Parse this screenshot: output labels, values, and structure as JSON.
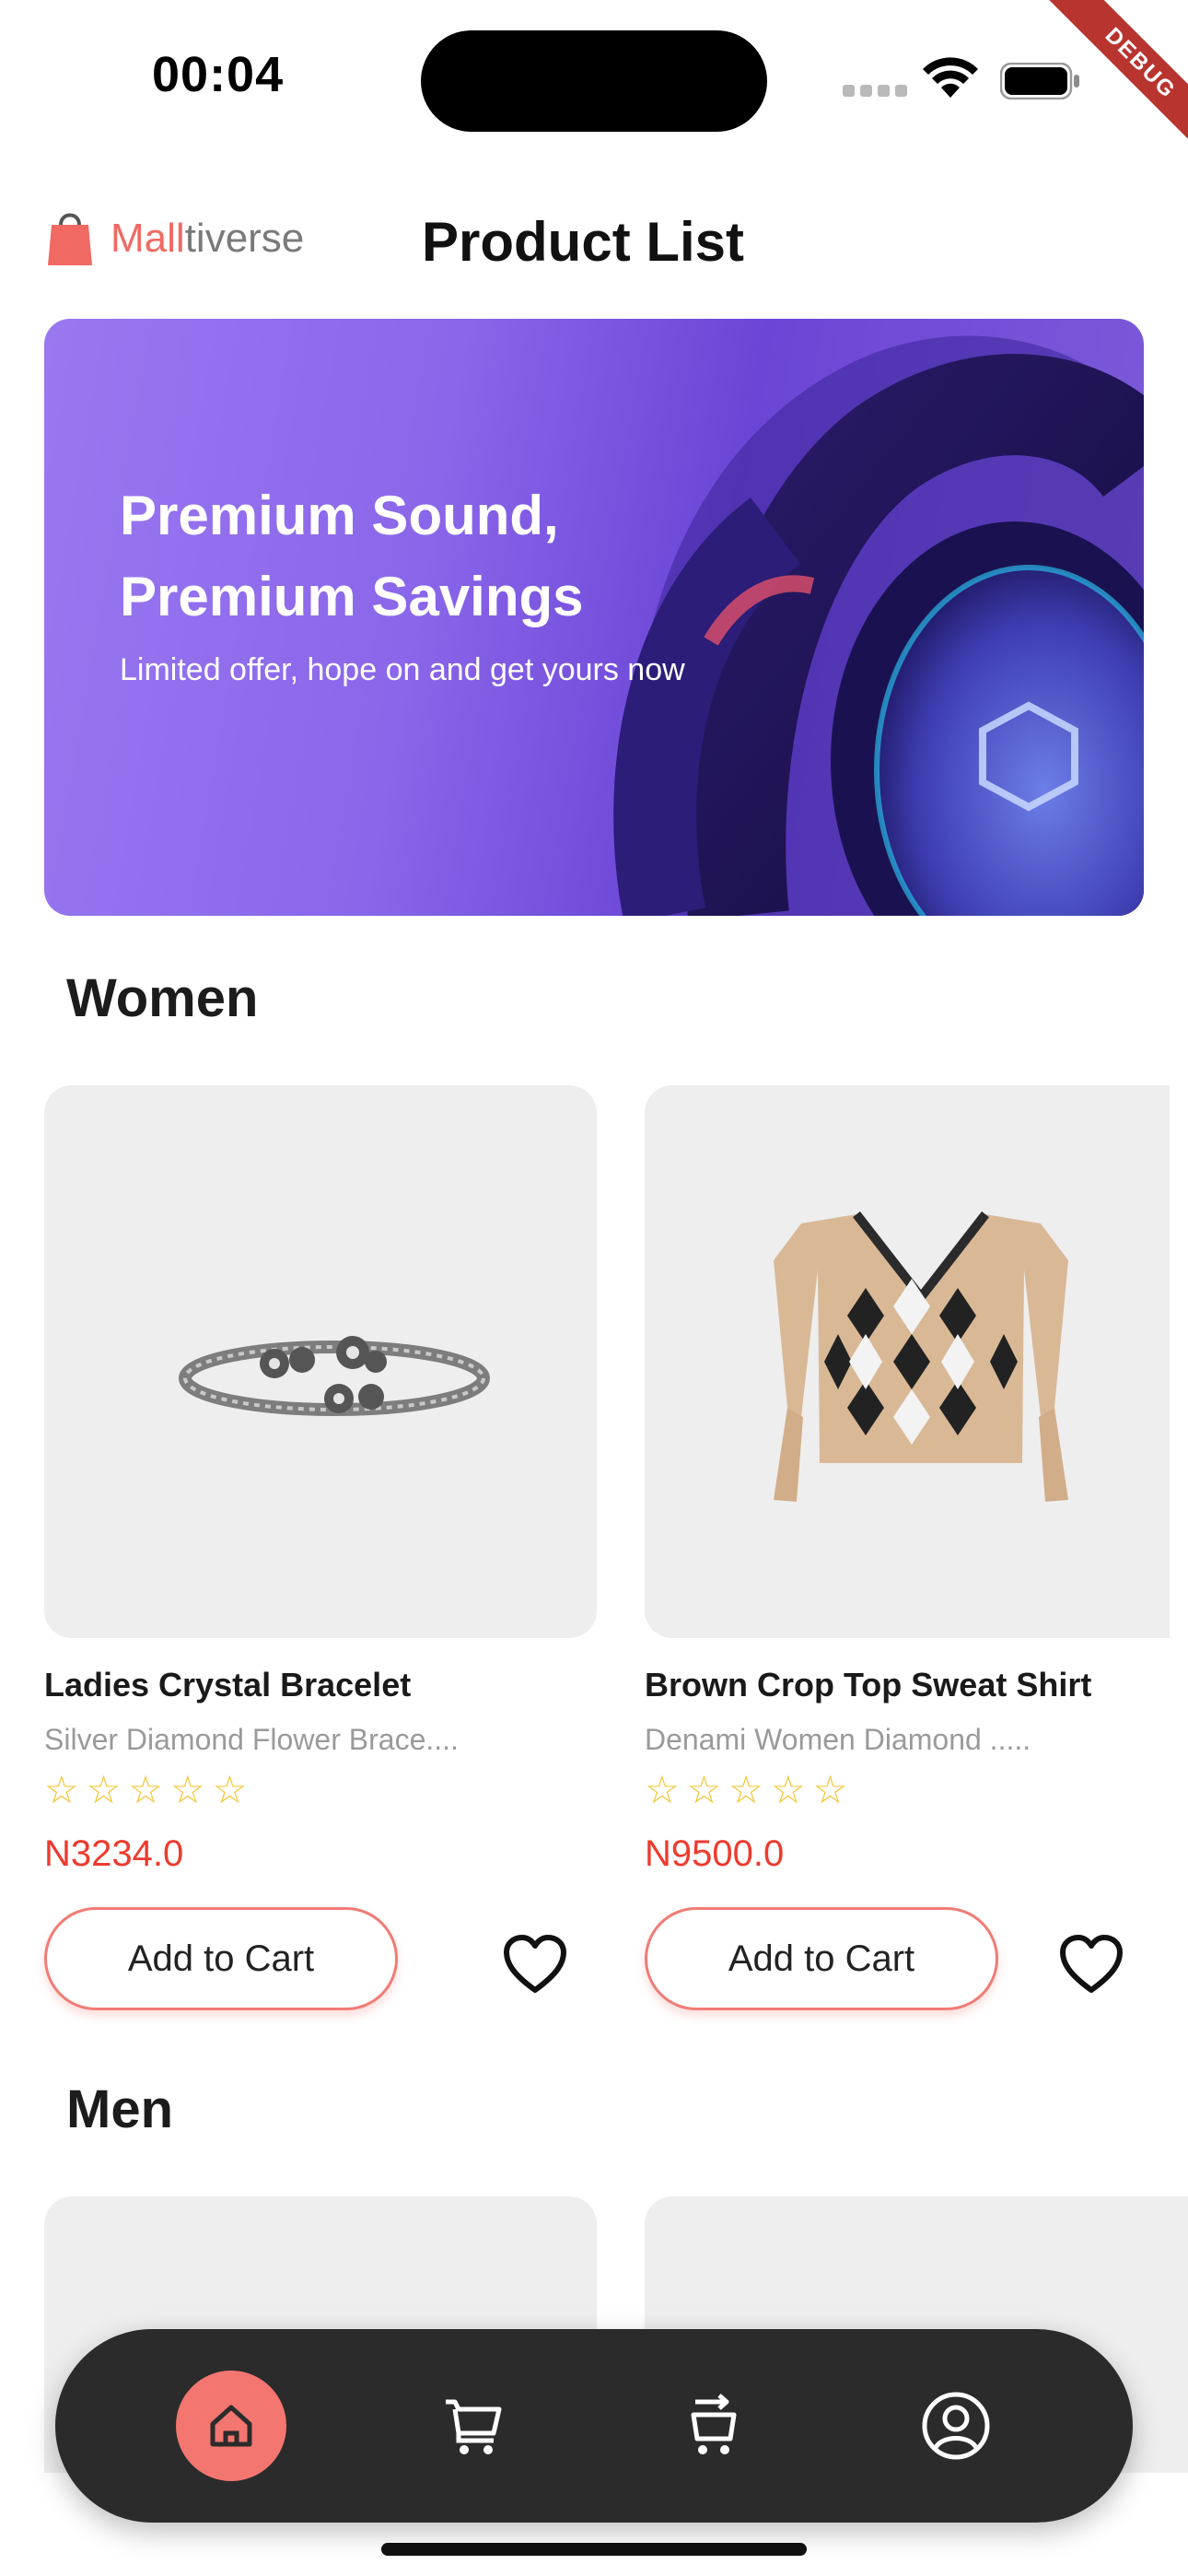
{
  "status_bar": {
    "time": "00:04",
    "debug_label": "DEBUG"
  },
  "header": {
    "logo": {
      "brand_part1": "Mall",
      "brand_part2": "tiverse"
    },
    "title": "Product List"
  },
  "banner": {
    "headline_line1": "Premium Sound,",
    "headline_line2": "Premium Savings",
    "subtitle": "Limited offer, hope on and get yours now"
  },
  "sections": [
    {
      "title": "Women",
      "products": [
        {
          "name": "Ladies Crystal Bracelet",
          "description": "Silver Diamond Flower Brace....",
          "rating_stars": "☆☆☆☆☆",
          "price": "N3234.0",
          "cart_label": "Add to Cart"
        },
        {
          "name": "Brown Crop Top Sweat Shirt",
          "description": "Denami Women Diamond .....",
          "rating_stars": "☆☆☆☆☆",
          "price": "N9500.0",
          "cart_label": "Add to Cart"
        }
      ]
    },
    {
      "title": "Men"
    }
  ],
  "bottom_nav": {
    "items": [
      {
        "icon": "home-icon",
        "active": true
      },
      {
        "icon": "cart-icon",
        "active": false
      },
      {
        "icon": "checkout-icon",
        "active": false
      },
      {
        "icon": "profile-icon",
        "active": false
      }
    ]
  },
  "colors": {
    "accent": "#f47670",
    "price": "#ec3b2e",
    "nav_bg": "#2b2b2b",
    "star": "#f4c430"
  }
}
